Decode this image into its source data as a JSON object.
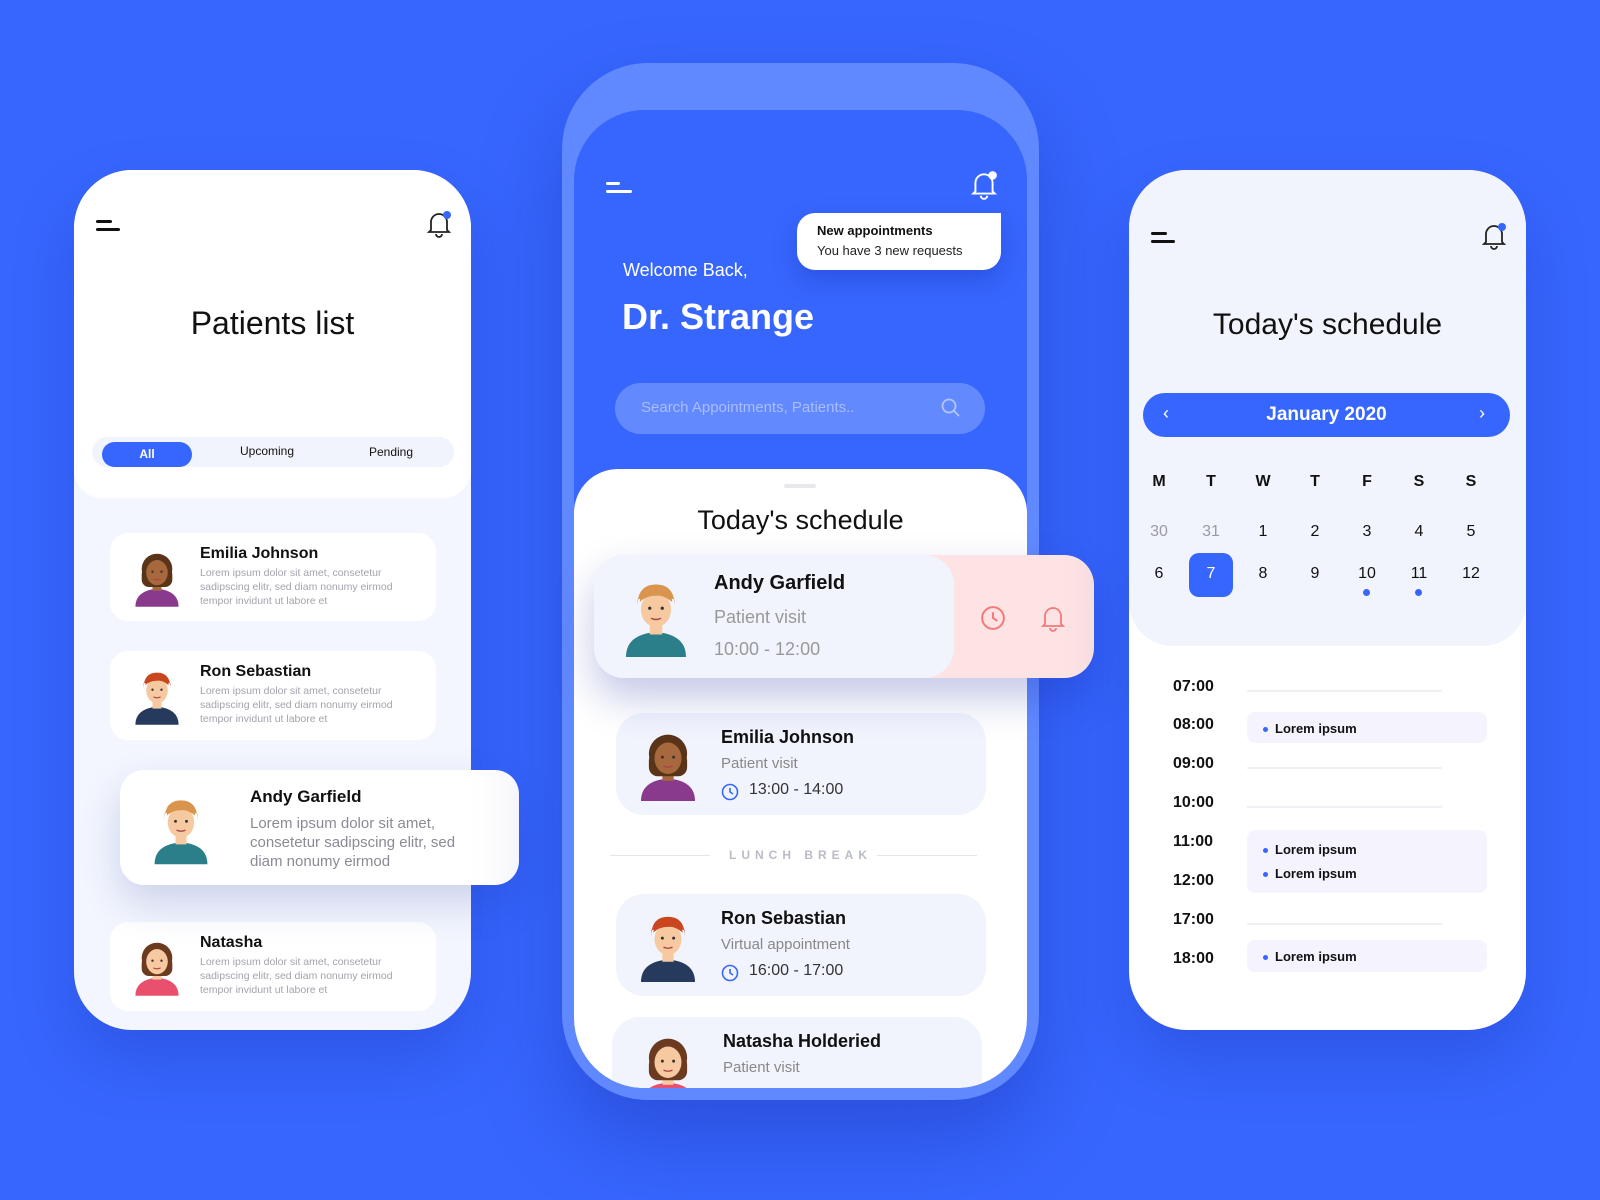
{
  "colors": {
    "background": "#3766fe",
    "accent": "#3766fe",
    "alert_bg": "#fde3e3",
    "alert_icon": "#f47a7a"
  },
  "patients_screen": {
    "title": "Patients list",
    "tabs": [
      {
        "label": "All",
        "active": true
      },
      {
        "label": "Upcoming",
        "active": false
      },
      {
        "label": "Pending",
        "active": false
      }
    ],
    "patients": [
      {
        "name": "Emilia Johnson",
        "desc": "Lorem ipsum dolor sit amet, consetetur sadipscing elitr, sed diam nonumy eirmod tempor invidunt ut labore et",
        "avatar": "emilia"
      },
      {
        "name": "Ron Sebastian",
        "desc": "Lorem ipsum dolor sit amet, consetetur sadipscing elitr, sed diam nonumy eirmod tempor invidunt ut labore et",
        "avatar": "ron"
      },
      {
        "name": "Andy Garfield",
        "desc": "Lorem ipsum dolor sit amet, consetetur sadipscing elitr, sed diam nonumy eirmod",
        "avatar": "andy"
      },
      {
        "name": "Natasha",
        "desc": "Lorem ipsum dolor sit amet, consetetur sadipscing elitr, sed diam nonumy eirmod tempor invidunt ut labore et",
        "avatar": "natasha"
      }
    ]
  },
  "home_screen": {
    "notification": {
      "title": "New appointments",
      "body": "You have 3 new requests"
    },
    "welcome": "Welcome  Back,",
    "doctor": "Dr. Strange",
    "search_placeholder": "Search Appointments, Patients..",
    "schedule_title": "Today's schedule",
    "appointments": [
      {
        "name": "Andy Garfield",
        "type": "Patient visit",
        "time": "10:00 - 12:00",
        "avatar": "andy"
      },
      {
        "name": "Emilia Johnson",
        "type": "Patient visit",
        "time": "13:00 - 14:00",
        "avatar": "emilia"
      },
      {
        "name": "Ron Sebastian",
        "type": "Virtual appointment",
        "time": "16:00 - 17:00",
        "avatar": "ron"
      },
      {
        "name": "Natasha Holderied",
        "type": "Patient visit",
        "time": "",
        "avatar": "natasha"
      }
    ],
    "lunch_break": "LUNCH BREAK"
  },
  "calendar_screen": {
    "title": "Today's schedule",
    "month": "January 2020",
    "weekdays": [
      "M",
      "T",
      "W",
      "T",
      "F",
      "S",
      "S"
    ],
    "weeks": [
      [
        "30",
        "31",
        "1",
        "2",
        "3",
        "4",
        "5"
      ],
      [
        "6",
        "7",
        "8",
        "9",
        "10",
        "11",
        "12"
      ]
    ],
    "selected_day": "7",
    "days_with_events": [
      "10",
      "11"
    ],
    "hours": [
      "07:00",
      "08:00",
      "09:00",
      "10:00",
      "11:00",
      "12:00",
      "17:00",
      "18:00"
    ],
    "events": [
      {
        "items": [
          "Lorem ipsum"
        ]
      },
      {
        "items": [
          "Lorem ipsum",
          "Lorem ipsum"
        ]
      },
      {
        "items": [
          "Lorem ipsum"
        ]
      }
    ]
  }
}
